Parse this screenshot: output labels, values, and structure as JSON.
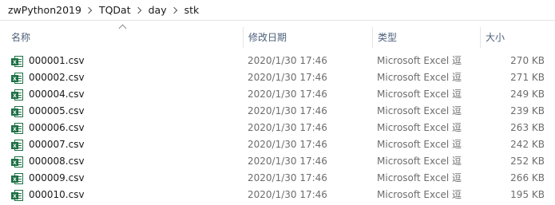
{
  "breadcrumb": [
    "zwPython2019",
    "TQDat",
    "day",
    "stk"
  ],
  "columns": {
    "name": "名称",
    "modified": "修改日期",
    "type": "类型",
    "size": "大小"
  },
  "files": [
    {
      "name": "000001.csv",
      "modified": "2020/1/30 17:46",
      "type": "Microsoft Excel 逗",
      "size": "270 KB"
    },
    {
      "name": "000002.csv",
      "modified": "2020/1/30 17:46",
      "type": "Microsoft Excel 逗",
      "size": "271 KB"
    },
    {
      "name": "000004.csv",
      "modified": "2020/1/30 17:46",
      "type": "Microsoft Excel 逗",
      "size": "249 KB"
    },
    {
      "name": "000005.csv",
      "modified": "2020/1/30 17:46",
      "type": "Microsoft Excel 逗",
      "size": "239 KB"
    },
    {
      "name": "000006.csv",
      "modified": "2020/1/30 17:46",
      "type": "Microsoft Excel 逗",
      "size": "263 KB"
    },
    {
      "name": "000007.csv",
      "modified": "2020/1/30 17:46",
      "type": "Microsoft Excel 逗",
      "size": "242 KB"
    },
    {
      "name": "000008.csv",
      "modified": "2020/1/30 17:46",
      "type": "Microsoft Excel 逗",
      "size": "252 KB"
    },
    {
      "name": "000009.csv",
      "modified": "2020/1/30 17:46",
      "type": "Microsoft Excel 逗",
      "size": "266 KB"
    },
    {
      "name": "000010.csv",
      "modified": "2020/1/30 17:46",
      "type": "Microsoft Excel 逗",
      "size": "195 KB"
    }
  ],
  "icons": {
    "file_icon": "excel-csv-icon",
    "separator": "chevron-right-icon",
    "sort": "sort-ascending-icon"
  },
  "colors": {
    "header_text": "#4c607a",
    "excel_green": "#1e7145",
    "secondary_text": "#6d6d6d"
  }
}
